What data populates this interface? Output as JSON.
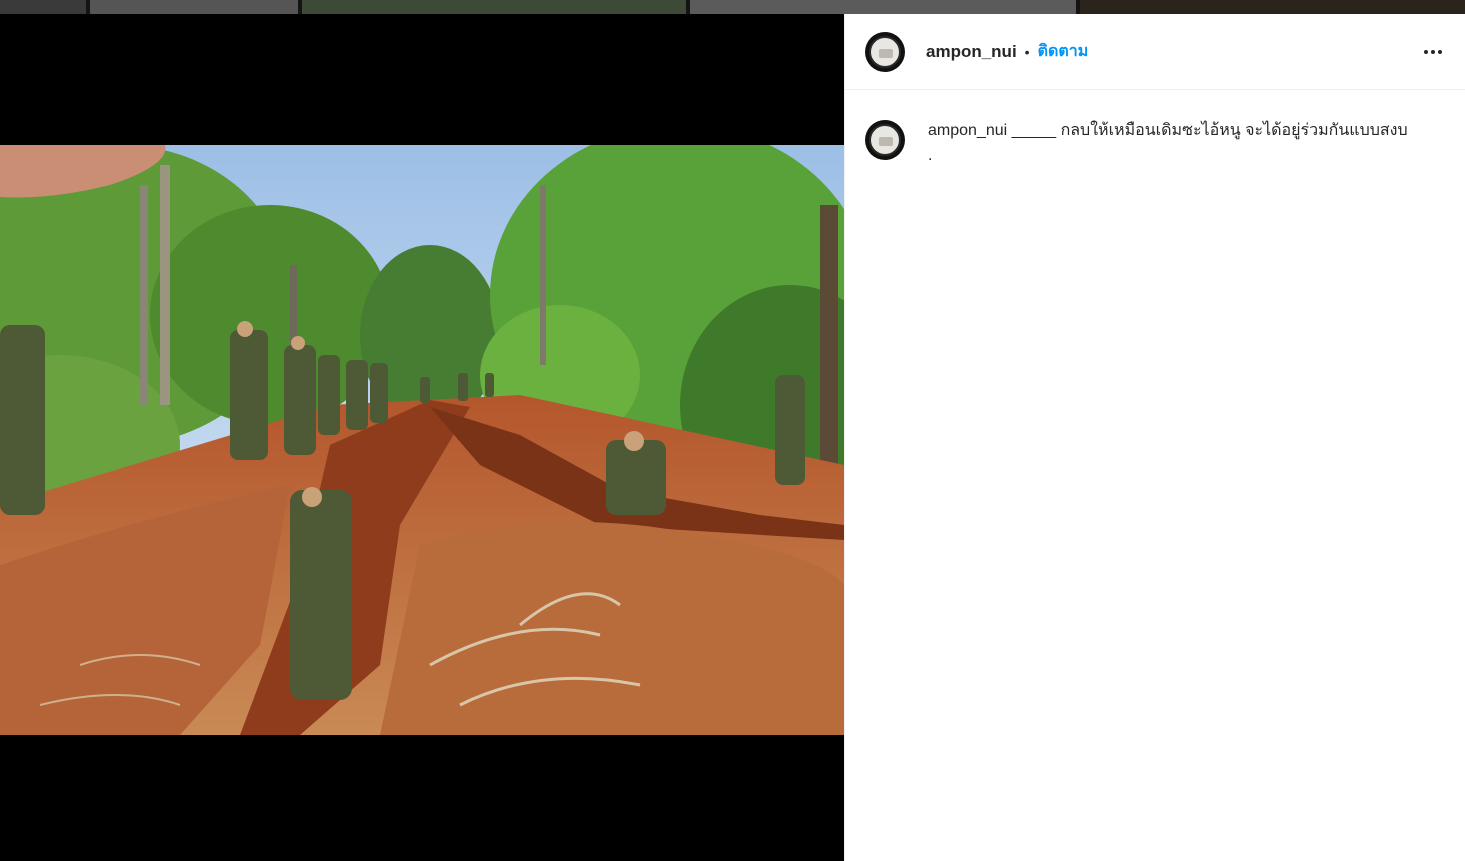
{
  "post": {
    "username": "ampon_nui",
    "separator": "•",
    "follow_label": "ติดตาม",
    "more_icon": "more-horizontal-icon"
  },
  "caption": {
    "username": "ampon_nui",
    "text": "_____ กลบให้เหมือนเดิมซะไอ้หนู จะได้อยู่ร่วมกันแบบสงบ",
    "line2": "."
  },
  "colors": {
    "follow_blue": "#0095f6",
    "text_dark": "#262626",
    "media_bg": "#000000"
  }
}
